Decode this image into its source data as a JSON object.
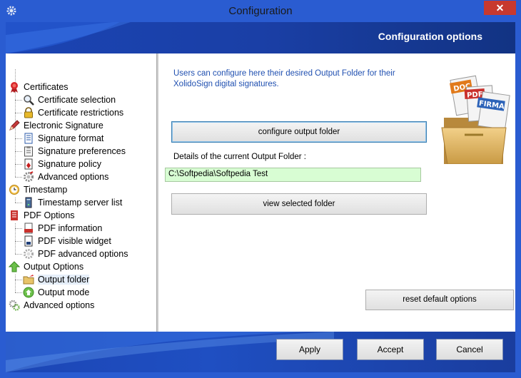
{
  "window": {
    "title": "Configuration",
    "close_label": "✕"
  },
  "header": {
    "title": "Configuration options"
  },
  "tree": [
    {
      "label": "Certificates",
      "icon": "ribbon-icon",
      "level": 0
    },
    {
      "label": "Certificate selection",
      "icon": "magnifier-icon",
      "level": 1
    },
    {
      "label": "Certificate restrictions",
      "icon": "padlock-icon",
      "level": 1
    },
    {
      "label": "Electronic Signature",
      "icon": "pen-icon",
      "level": 0
    },
    {
      "label": "Signature format",
      "icon": "document-icon",
      "level": 1
    },
    {
      "label": "Signature preferences",
      "icon": "clipboard-icon",
      "level": 1
    },
    {
      "label": "Signature policy",
      "icon": "policy-icon",
      "level": 1
    },
    {
      "label": "Advanced options",
      "icon": "gear-icon",
      "level": 1
    },
    {
      "label": "Timestamp",
      "icon": "clock-icon",
      "level": 0
    },
    {
      "label": "Timestamp server list",
      "icon": "server-icon",
      "level": 1
    },
    {
      "label": "PDF Options",
      "icon": "pdf-icon",
      "level": 0
    },
    {
      "label": "PDF information",
      "icon": "pdf-info-icon",
      "level": 1
    },
    {
      "label": "PDF visible widget",
      "icon": "widget-icon",
      "level": 1
    },
    {
      "label": "PDF advanced options",
      "icon": "gear-icon",
      "level": 1
    },
    {
      "label": "Output Options",
      "icon": "arrow-up-icon",
      "level": 0
    },
    {
      "label": "Output folder",
      "icon": "folder-icon",
      "level": 1,
      "selected": true
    },
    {
      "label": "Output mode",
      "icon": "output-mode-icon",
      "level": 1
    },
    {
      "label": "Advanced options",
      "icon": "gears-icon",
      "level": 0
    }
  ],
  "main": {
    "info": "Users can configure here their desired Output Folder for their XolidoSign digital signatures.",
    "configure_button": "configure output folder",
    "details_label": "Details of the current Output Folder :",
    "current_folder": "C:\\Softpedia\\Softpedia Test",
    "view_button": "view selected folder",
    "reset_button": "reset default options",
    "art_labels": [
      "DOC",
      "PDF",
      "FIRMA"
    ]
  },
  "footer": {
    "apply": "Apply",
    "accept": "Accept",
    "cancel": "Cancel"
  },
  "colors": {
    "title_bar": "#2a5cd1",
    "close_button": "#c7392e",
    "info_text": "#1f4fb0",
    "path_field_bg": "#d8fdd3"
  }
}
